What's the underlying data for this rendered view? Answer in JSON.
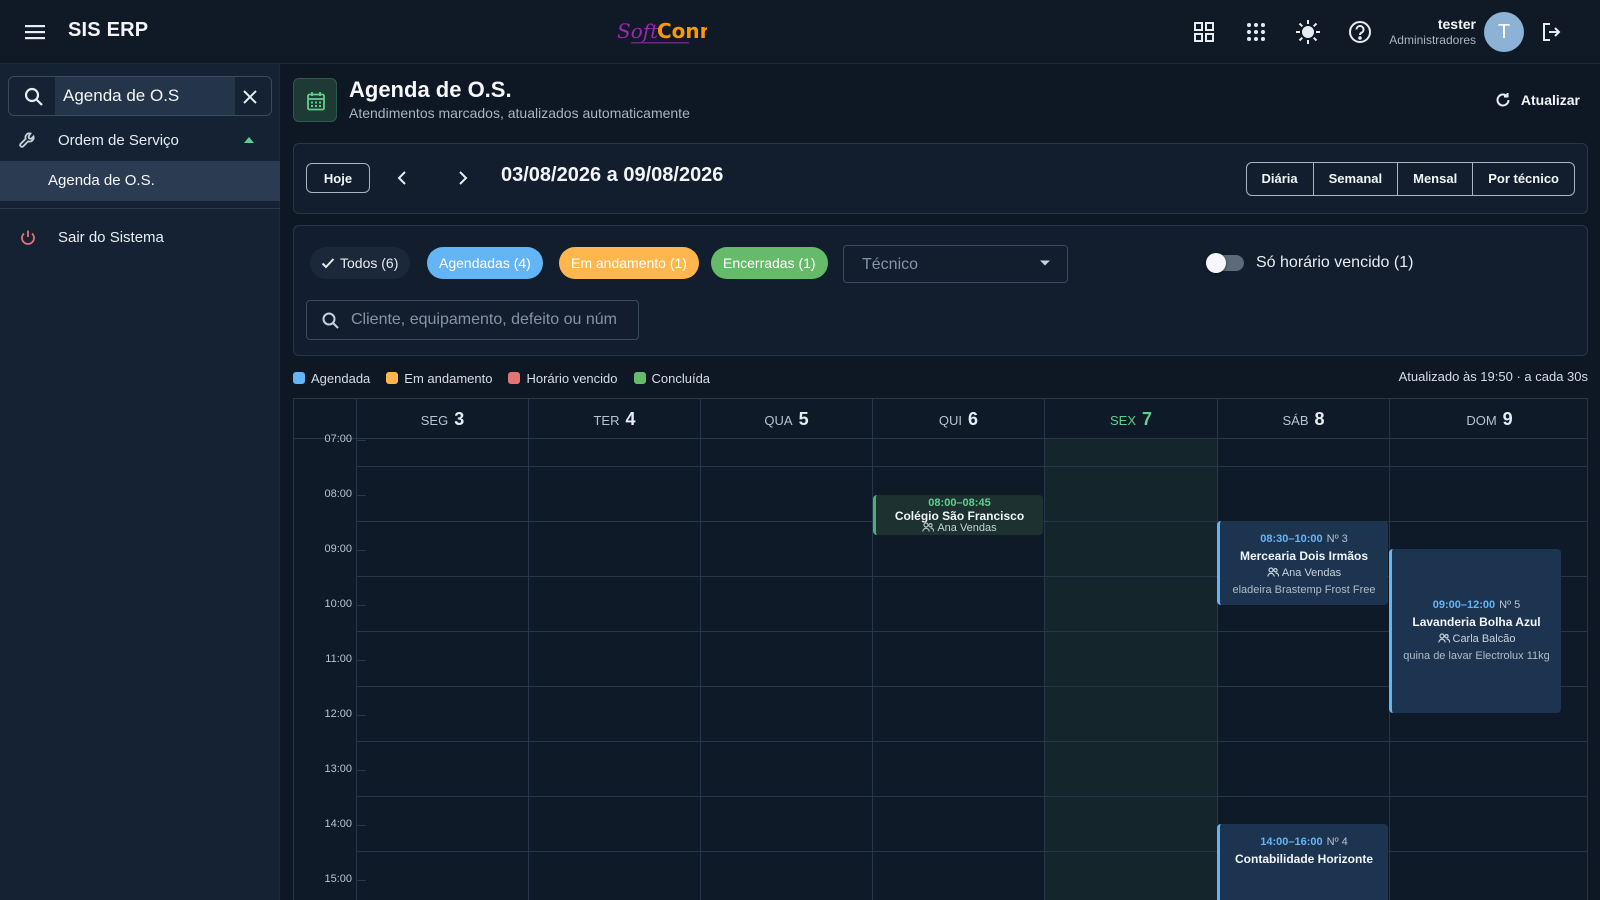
{
  "app": {
    "title": "SIS ERP",
    "logo_text": "SoftConn"
  },
  "user": {
    "name": "tester",
    "role": "Administradores",
    "avatar_letter": "T"
  },
  "sidebar": {
    "search_value": "Agenda de O.S",
    "items": [
      {
        "label": "Ordem de Serviço"
      },
      {
        "label": "Agenda de O.S."
      },
      {
        "label": "Sair do Sistema"
      }
    ]
  },
  "page": {
    "title": "Agenda de O.S.",
    "subtitle": "Atendimentos marcados, atualizados automaticamente",
    "refresh_label": "Atualizar"
  },
  "toolbar": {
    "today_label": "Hoje",
    "range": "03/08/2026 a 09/08/2026",
    "views": [
      "Diária",
      "Semanal",
      "Mensal",
      "Por técnico"
    ]
  },
  "filters": {
    "all": "Todos (6)",
    "scheduled": "Agendadas (4)",
    "in_progress": "Em andamento (1)",
    "closed": "Encerradas (1)",
    "tech_placeholder": "Técnico",
    "overdue_toggle": "Só horário vencido (1)",
    "overdue_on": false,
    "search_placeholder": "Cliente, equipamento, defeito ou núm"
  },
  "legend": {
    "items": [
      {
        "label": "Agendada",
        "color": "#64b5f6"
      },
      {
        "label": "Em andamento",
        "color": "#ffb74d"
      },
      {
        "label": "Horário vencido",
        "color": "#e57373"
      },
      {
        "label": "Concluída",
        "color": "#66bb6a"
      }
    ],
    "updated": "Atualizado às 19:50 · a cada 30s"
  },
  "calendar": {
    "days": [
      {
        "wd": "SEG",
        "num": "3"
      },
      {
        "wd": "TER",
        "num": "4"
      },
      {
        "wd": "QUA",
        "num": "5"
      },
      {
        "wd": "QUI",
        "num": "6"
      },
      {
        "wd": "SEX",
        "num": "7"
      },
      {
        "wd": "SÁB",
        "num": "8"
      },
      {
        "wd": "DOM",
        "num": "9"
      }
    ],
    "hours": [
      "07:00",
      "08:00",
      "09:00",
      "10:00",
      "11:00",
      "12:00",
      "13:00",
      "14:00",
      "15:00"
    ],
    "events": [
      {
        "time": "08:00–08:45",
        "number": "",
        "client": "Colégio São Francisco",
        "tech": "Ana Vendas",
        "equipment": ""
      },
      {
        "time": "08:30–10:00",
        "number": "Nº 3",
        "client": "Mercearia Dois Irmãos",
        "tech": "Ana Vendas",
        "equipment": "eladeira Brastemp Frost Free"
      },
      {
        "time": "09:00–12:00",
        "number": "Nº 5",
        "client": "Lavanderia Bolha Azul",
        "tech": "Carla Balcão",
        "equipment": "quina de lavar Electrolux 11kg"
      },
      {
        "time": "14:00–16:00",
        "number": "Nº 4",
        "client": "Contabilidade Horizonte",
        "tech": "",
        "equipment": ""
      }
    ]
  },
  "icons": [
    "menu-icon",
    "apps-grid-icon",
    "dots-grid-icon",
    "sun-icon",
    "help-icon",
    "logout-icon",
    "search-icon",
    "close-icon",
    "wrench-icon",
    "chevron-up-icon",
    "power-icon",
    "calendar-icon",
    "refresh-icon",
    "chevron-left-icon",
    "chevron-right-icon",
    "check-icon",
    "caret-down-icon",
    "people-icon"
  ]
}
